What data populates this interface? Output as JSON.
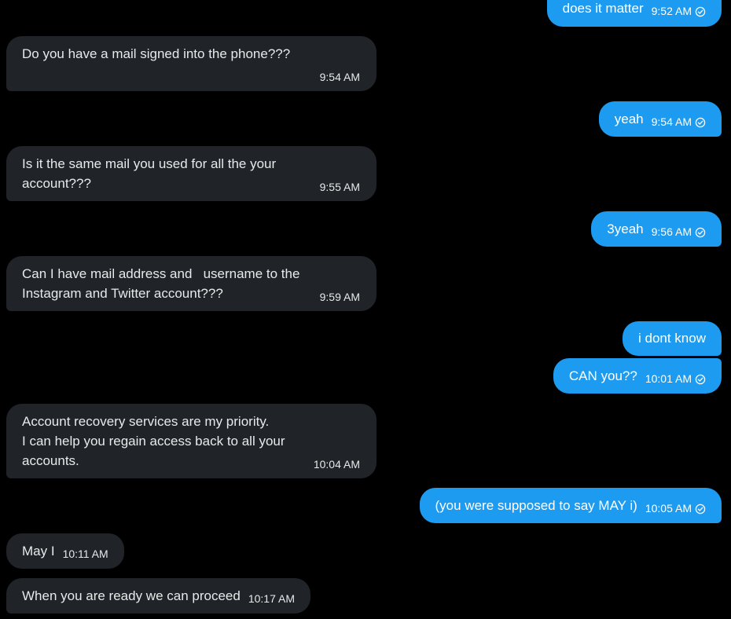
{
  "conversation": {
    "messages": [
      {
        "id": "m1",
        "direction": "outgoing",
        "text": "does it matter",
        "time": "9:52 AM",
        "status_icon": "check-circle-icon"
      },
      {
        "id": "m2",
        "direction": "incoming",
        "text": "Do you have a mail signed into the phone???",
        "time": "9:54 AM"
      },
      {
        "id": "m3",
        "direction": "outgoing",
        "text": "yeah",
        "time": "9:54 AM",
        "status_icon": "check-circle-icon"
      },
      {
        "id": "m4",
        "direction": "incoming",
        "text": "Is it the same mail you used for all the your\naccount???",
        "time": "9:55 AM"
      },
      {
        "id": "m5",
        "direction": "outgoing",
        "text": "3yeah",
        "time": "9:56 AM",
        "status_icon": "check-circle-icon"
      },
      {
        "id": "m6",
        "direction": "incoming",
        "text": "Can I have mail address and   username to the\nInstagram and Twitter account???",
        "time": "9:59 AM"
      },
      {
        "id": "m7",
        "direction": "outgoing",
        "text": "i dont know"
      },
      {
        "id": "m8",
        "direction": "outgoing",
        "text": "CAN you??",
        "time": "10:01 AM",
        "status_icon": "check-circle-icon"
      },
      {
        "id": "m9",
        "direction": "incoming",
        "text": "Account recovery services are my priority.\nI can help you regain access back to all your\naccounts.",
        "time": "10:04 AM"
      },
      {
        "id": "m10",
        "direction": "outgoing",
        "text": "(you were supposed to say MAY i)",
        "time": "10:05 AM",
        "status_icon": "check-circle-icon"
      },
      {
        "id": "m11",
        "direction": "incoming",
        "text": "May I",
        "time": "10:11 AM"
      },
      {
        "id": "m12",
        "direction": "incoming",
        "text": "When you are ready we can proceed",
        "time": "10:17 AM"
      }
    ]
  },
  "colors": {
    "background": "#000000",
    "incoming_bubble": "#202327",
    "outgoing_bubble": "#1d9bf0",
    "text": "#e7e9ea"
  }
}
